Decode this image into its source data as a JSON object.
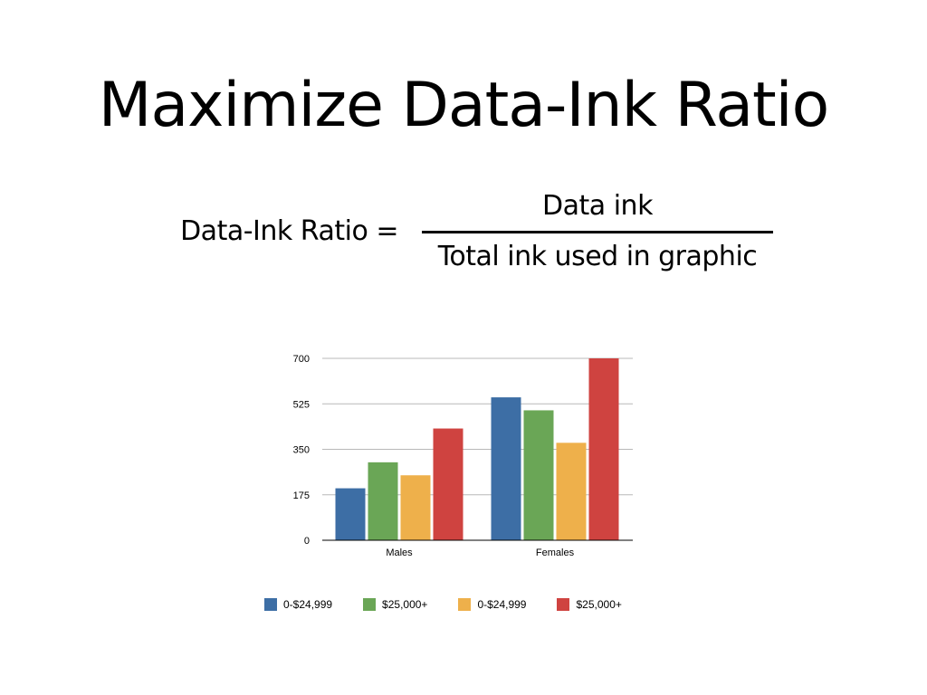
{
  "slide": {
    "title": "Maximize Data-Ink Ratio",
    "formula": {
      "label": "Data-Ink Ratio =",
      "numerator": "Data ink",
      "denominator": "Total ink used in graphic"
    }
  },
  "chart_data": {
    "type": "bar",
    "title": "",
    "xlabel": "",
    "ylabel": "",
    "categories": [
      "Males",
      "Females"
    ],
    "ylim": [
      0,
      700
    ],
    "yticks": [
      "0",
      "175",
      "350",
      "525",
      "700"
    ],
    "grid": true,
    "legend_position": "bottom",
    "series": [
      {
        "name": "0-$24,999",
        "color": "#3d6ea5",
        "values": [
          200,
          550
        ]
      },
      {
        "name": "$25,000+",
        "color": "#6aa656",
        "values": [
          300,
          500
        ]
      },
      {
        "name": "0-$24,999",
        "color": "#eeb04b",
        "values": [
          250,
          375
        ]
      },
      {
        "name": "$25,000+",
        "color": "#cf4340",
        "values": [
          430,
          700
        ]
      }
    ]
  }
}
